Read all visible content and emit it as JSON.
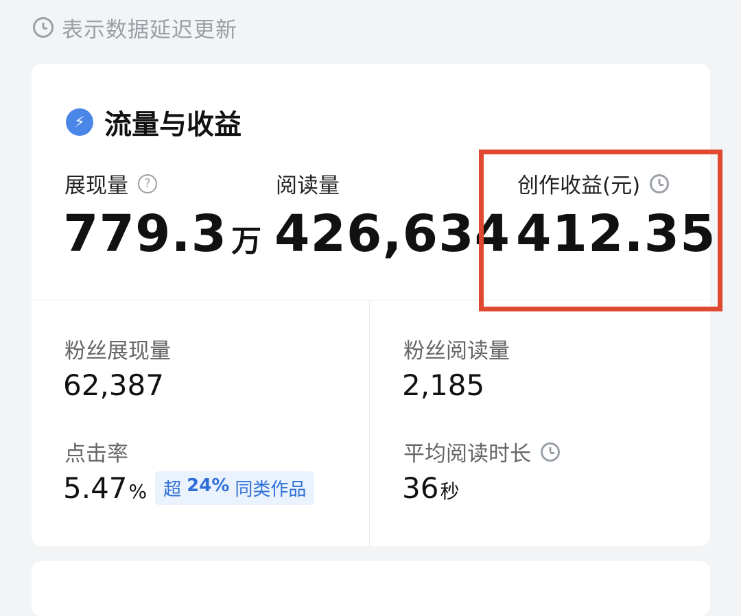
{
  "notice": {
    "icon": "clock-icon",
    "text": "表示数据延迟更新"
  },
  "section": {
    "icon": "bolt-icon",
    "title": "流量与收益"
  },
  "metrics": {
    "impressions": {
      "label": "展现量",
      "value": "779.3",
      "unit": "万"
    },
    "reads": {
      "label": "阅读量",
      "value": "426,634"
    },
    "earnings": {
      "label": "创作收益(元)",
      "value": "412.35"
    }
  },
  "stats": {
    "fan_impressions": {
      "label": "粉丝展现量",
      "value": "62,387"
    },
    "fan_reads": {
      "label": "粉丝阅读量",
      "value": "2,185"
    },
    "ctr": {
      "label": "点击率",
      "value": "5.47",
      "unit": "%",
      "badge_prefix": "超",
      "badge_pct": "24%",
      "badge_suffix": "同类作品"
    },
    "avg_read_time": {
      "label": "平均阅读时长",
      "value": "36",
      "unit": "秒"
    }
  },
  "colors": {
    "highlight_border": "#e0482f",
    "accent_blue": "#4a86e8",
    "badge_bg": "#eaf2fd",
    "badge_text": "#2f6fd6",
    "background": "#f3f4f6"
  }
}
